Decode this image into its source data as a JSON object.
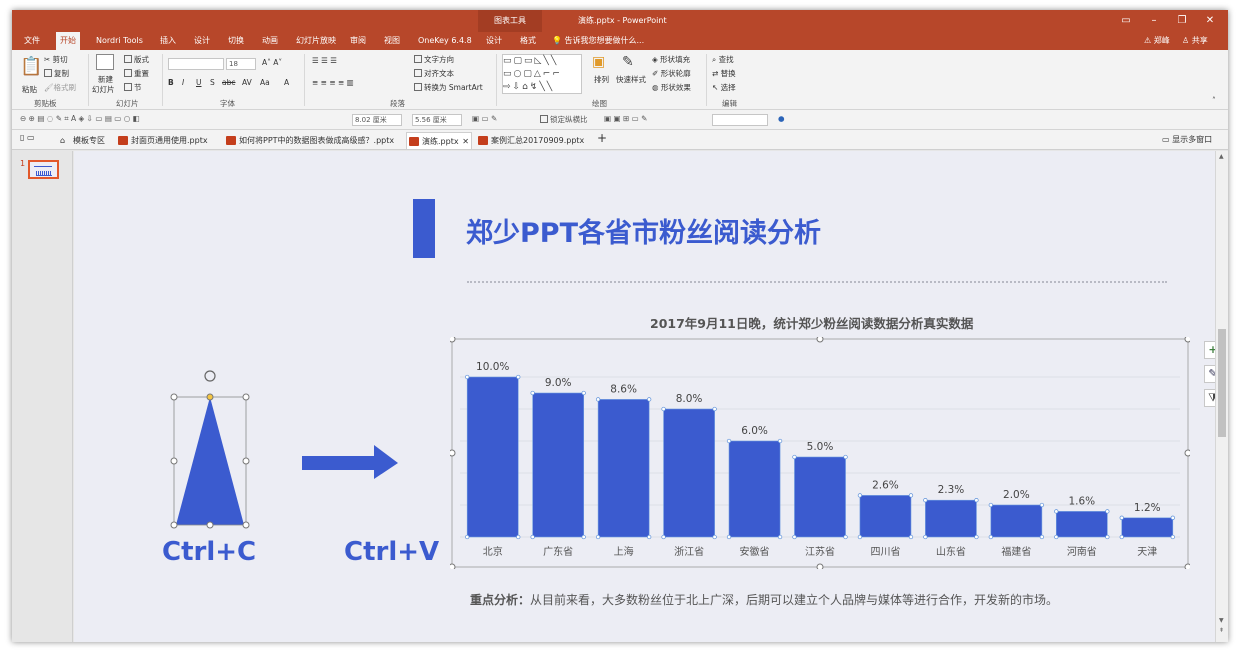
{
  "titlebar": {
    "context_tab": "图表工具",
    "doc_title": "演练.pptx - PowerPoint",
    "btn_restore_icon": "▭",
    "btn_min": "–",
    "btn_max": "❐",
    "btn_close": "✕"
  },
  "tabs": [
    "文件",
    "开始",
    "Nordri Tools",
    "插入",
    "设计",
    "切换",
    "动画",
    "幻灯片放映",
    "审阅",
    "视图",
    "OneKey 6.4.8",
    "设计",
    "格式"
  ],
  "active_tab": "开始",
  "tell_me": "告诉我您想要做什么...",
  "user": "郑峰",
  "share": "共享",
  "ribbon": {
    "clipboard": {
      "paste": "粘贴",
      "cut": "剪切",
      "copy": "复制",
      "format_painter": "格式刷",
      "label": "剪贴板"
    },
    "slides": {
      "new_slide": "新建",
      "new_slide2": "幻灯片",
      "layout": "版式",
      "reset": "重置",
      "section": "节",
      "label": "幻灯片"
    },
    "font": {
      "font_name": "",
      "font_size": "18",
      "bold": "B",
      "italic": "I",
      "underline": "U",
      "shadow": "S",
      "strike": "abc",
      "spacing": "AV",
      "case": "Aa",
      "color": "A",
      "label": "字体"
    },
    "paragraph": {
      "text_direction": "文字方向",
      "align_text": "对齐文本",
      "smartart": "转换为 SmartArt",
      "label": "段落"
    },
    "drawing": {
      "arrange": "排列",
      "quick_styles": "快速样式",
      "shape_fill": "形状填充",
      "shape_outline": "形状轮廓",
      "shape_effects": "形状效果",
      "label": "绘图"
    },
    "editing": {
      "find": "查找",
      "replace": "替换",
      "select": "选择",
      "label": "编辑"
    }
  },
  "qbar": {
    "width": "8.02 厘米",
    "height": "5.56 厘米",
    "lock_ratio": "锁定纵横比"
  },
  "file_tabs": [
    {
      "label": "模板专区",
      "active": false
    },
    {
      "label": "封面页通用使用.pptx",
      "active": false
    },
    {
      "label": "如何将PPT中的数据图表做成高级感？.pptx",
      "active": false
    },
    {
      "label": "演练.pptx",
      "active": true
    },
    {
      "label": "案例汇总20170909.pptx",
      "active": false
    }
  ],
  "multi_window": "显示多窗口",
  "slide_number": "1",
  "slide": {
    "title": "郑少PPT各省市粉丝阅读分析",
    "chart_subtitle": "2017年9月11日晚，统计郑少粉丝阅读数据分析真实数据",
    "ctrl_c": "Ctrl+C",
    "ctrl_v": "Ctrl+V",
    "analysis_label": "重点分析：",
    "analysis_text": "从目前来看，大多数粉丝位于北上广深，后期可以建立个人品牌与媒体等进行合作，开发新的市场。"
  },
  "chart_data": {
    "type": "bar",
    "categories": [
      "北京",
      "广东省",
      "上海",
      "浙江省",
      "安徽省",
      "江苏省",
      "四川省",
      "山东省",
      "福建省",
      "河南省",
      "天津"
    ],
    "values": [
      10.0,
      9.0,
      8.6,
      8.0,
      6.0,
      5.0,
      2.6,
      2.3,
      2.0,
      1.6,
      1.2
    ],
    "labels": [
      "10.0%",
      "9.0%",
      "8.6%",
      "8.0%",
      "6.0%",
      "5.0%",
      "2.6%",
      "2.3%",
      "2.0%",
      "1.6%",
      "1.2%"
    ],
    "title": "2017年9月11日晚，统计郑少粉丝阅读数据分析真实数据",
    "ylim": [
      0,
      10
    ],
    "bar_color": "#3b5bcf",
    "grid": true
  },
  "colors": {
    "accent": "#3b5bcf",
    "ribbon_bar": "#b7472a"
  },
  "icons": {
    "add": "+",
    "brush": "✎",
    "filter": "⧩"
  }
}
